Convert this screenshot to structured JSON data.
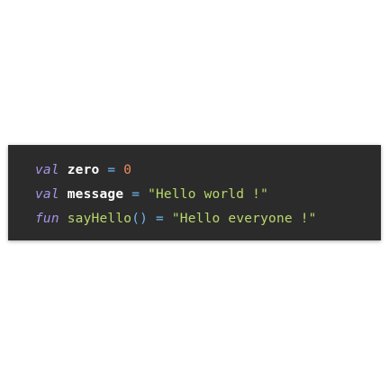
{
  "code": {
    "lines": [
      {
        "keyword": "val",
        "name": "zero",
        "operator": "=",
        "value": "0"
      },
      {
        "keyword": "val",
        "name": "message",
        "operator": "=",
        "value": "\"Hello world !\""
      },
      {
        "keyword": "fun",
        "name": "sayHello",
        "parens": "()",
        "operator": "=",
        "value": "\"Hello everyone !\""
      }
    ]
  },
  "colors": {
    "background": "#2b2b2b",
    "keyword": "#a794e6",
    "identifier": "#ffffff",
    "operator": "#6fb7f0",
    "number": "#f08a5a",
    "string": "#b8d86a"
  }
}
